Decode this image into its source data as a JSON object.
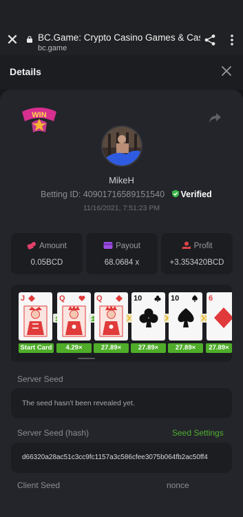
{
  "browser": {
    "title": "BC.Game: Crypto Casino Games & Casino…",
    "url": "bc.game"
  },
  "header": {
    "title": "Details"
  },
  "player": {
    "name": "MikeH",
    "betting_id_label": "Betting ID: 40901716589151540",
    "verified_label": "Verified",
    "timestamp": "11/16/2021, 7:51:23 PM"
  },
  "badge": {
    "text": "WIN"
  },
  "stats": {
    "amount": {
      "label": "Amount",
      "value": "0.05BCD",
      "icon": "coins-icon"
    },
    "payout": {
      "label": "Payout",
      "value": "68.0684 x",
      "icon": "wallet-icon"
    },
    "profit": {
      "label": "Profit",
      "value": "+3.353420BCD",
      "icon": "hand-coin-icon"
    }
  },
  "cards": [
    {
      "rank": "J",
      "suit": "diamonds",
      "color": "#e03a3a"
    },
    {
      "rank": "Q",
      "suit": "hearts",
      "color": "#e03a3a"
    },
    {
      "rank": "Q",
      "suit": "diamonds",
      "color": "#e03a3a"
    },
    {
      "rank": "10",
      "suit": "clubs",
      "color": "#111111"
    },
    {
      "rank": "10",
      "suit": "spades",
      "color": "#111111"
    },
    {
      "rank": "6",
      "suit": "diamonds",
      "color": "#e03a3a"
    }
  ],
  "multipliers": [
    "Start Card",
    "4.29×",
    "27.89×",
    "27.89×",
    "27.89×",
    "27.89×"
  ],
  "seeds": {
    "server_seed_label": "Server Seed",
    "server_seed_value": "The seed hasn't been revealed yet.",
    "server_hash_label": "Server Seed (hash)",
    "seed_settings_label": "Seed Settings",
    "server_hash_value": "d66320a28ac51c3cc9fc1157a3c586cfee3075b064fb2ac50ff4",
    "client_seed_label": "Client Seed",
    "nonce_label": "nonce"
  },
  "colors": {
    "accent_green": "#4fae32",
    "multiplier_green": "#4fad2a",
    "panel": "#24252a",
    "box": "#1c1d21"
  }
}
